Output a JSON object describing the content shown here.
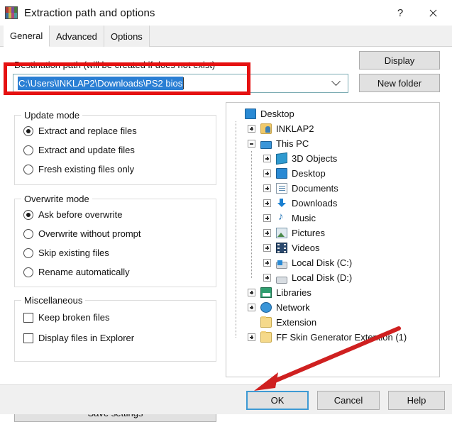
{
  "window": {
    "title": "Extraction path and options",
    "icon": "winrar-books-icon",
    "help_button": "?",
    "close_button": "✕"
  },
  "tabs": [
    {
      "label": "General",
      "active": true
    },
    {
      "label": "Advanced",
      "active": false
    },
    {
      "label": "Options",
      "active": false
    }
  ],
  "destination": {
    "label": "Destination path (will be created if does not exist)",
    "value": "C:\\Users\\INKLAP2\\Downloads\\PS2 bios",
    "selected": true,
    "dropdown_icon": "chevron-down-icon"
  },
  "side_buttons": {
    "display": "Display",
    "new_folder": "New folder"
  },
  "update_mode": {
    "legend": "Update mode",
    "options": [
      {
        "label": "Extract and replace files",
        "selected": true
      },
      {
        "label": "Extract and update files",
        "selected": false
      },
      {
        "label": "Fresh existing files only",
        "selected": false
      }
    ]
  },
  "overwrite_mode": {
    "legend": "Overwrite mode",
    "options": [
      {
        "label": "Ask before overwrite",
        "selected": true
      },
      {
        "label": "Overwrite without prompt",
        "selected": false
      },
      {
        "label": "Skip existing files",
        "selected": false
      },
      {
        "label": "Rename automatically",
        "selected": false
      }
    ]
  },
  "miscellaneous": {
    "legend": "Miscellaneous",
    "options": [
      {
        "label": "Keep broken files",
        "checked": false
      },
      {
        "label": "Display files in Explorer",
        "checked": false
      }
    ]
  },
  "save_settings_button": "Save settings",
  "folder_tree": [
    {
      "label": "Desktop",
      "icon": "monitor-icon",
      "depth": 0,
      "expander": "none"
    },
    {
      "label": "INKLAP2",
      "icon": "user-icon",
      "depth": 1,
      "expander": "plus"
    },
    {
      "label": "This PC",
      "icon": "pc-icon",
      "depth": 1,
      "expander": "minus"
    },
    {
      "label": "3D Objects",
      "icon": "cube-icon",
      "depth": 2,
      "expander": "plus"
    },
    {
      "label": "Desktop",
      "icon": "monitor-icon",
      "depth": 2,
      "expander": "plus"
    },
    {
      "label": "Documents",
      "icon": "document-icon",
      "depth": 2,
      "expander": "plus"
    },
    {
      "label": "Downloads",
      "icon": "download-icon",
      "depth": 2,
      "expander": "plus"
    },
    {
      "label": "Music",
      "icon": "music-icon",
      "depth": 2,
      "expander": "plus"
    },
    {
      "label": "Pictures",
      "icon": "picture-icon",
      "depth": 2,
      "expander": "plus"
    },
    {
      "label": "Videos",
      "icon": "video-icon",
      "depth": 2,
      "expander": "plus"
    },
    {
      "label": "Local Disk (C:)",
      "icon": "drive-c-icon",
      "depth": 2,
      "expander": "plus"
    },
    {
      "label": "Local Disk (D:)",
      "icon": "drive-icon",
      "depth": 2,
      "expander": "plus"
    },
    {
      "label": "Libraries",
      "icon": "library-icon",
      "depth": 1,
      "expander": "plus"
    },
    {
      "label": "Network",
      "icon": "network-icon",
      "depth": 1,
      "expander": "plus"
    },
    {
      "label": "Extension",
      "icon": "folder-icon",
      "depth": 1,
      "expander": "none"
    },
    {
      "label": "FF Skin Generator Extention (1)",
      "icon": "folder-icon",
      "depth": 1,
      "expander": "plus"
    }
  ],
  "bottom_buttons": {
    "ok": "OK",
    "cancel": "Cancel",
    "help": "Help",
    "default_focus": "ok"
  },
  "annotations": {
    "highlight_color": "#e51111",
    "rect_target": "destination-path-combobox",
    "arrow_target": "ok-button"
  }
}
